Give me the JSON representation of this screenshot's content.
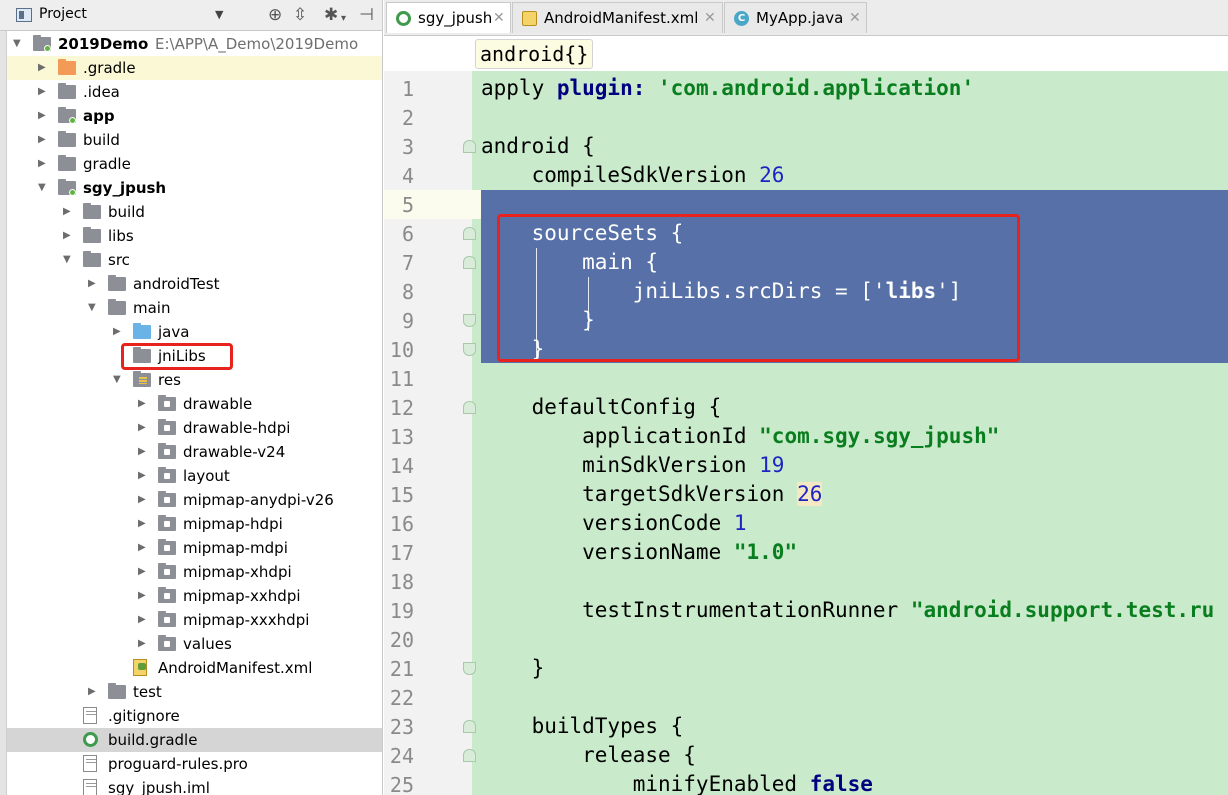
{
  "project_panel": {
    "title": "Project",
    "tree": [
      {
        "label": "2019Demo",
        "path": "E:\\APP\\A_Demo\\2019Demo",
        "depth": 0,
        "expanded": true,
        "icon": "module-folder-icon",
        "bold": true
      },
      {
        "label": ".gradle",
        "depth": 1,
        "expanded": false,
        "icon": "folder-orange-icon",
        "selected": "yellow"
      },
      {
        "label": ".idea",
        "depth": 1,
        "expanded": false,
        "icon": "folder-icon"
      },
      {
        "label": "app",
        "depth": 1,
        "expanded": false,
        "icon": "module-folder-icon",
        "bold": true
      },
      {
        "label": "build",
        "depth": 1,
        "expanded": false,
        "icon": "folder-icon"
      },
      {
        "label": "gradle",
        "depth": 1,
        "expanded": false,
        "icon": "folder-icon"
      },
      {
        "label": "sgy_jpush",
        "depth": 1,
        "expanded": true,
        "icon": "module-folder-icon",
        "bold": true
      },
      {
        "label": "build",
        "depth": 2,
        "expanded": false,
        "icon": "folder-icon"
      },
      {
        "label": "libs",
        "depth": 2,
        "expanded": false,
        "icon": "folder-icon"
      },
      {
        "label": "src",
        "depth": 2,
        "expanded": true,
        "icon": "folder-icon"
      },
      {
        "label": "androidTest",
        "depth": 3,
        "expanded": false,
        "icon": "folder-icon"
      },
      {
        "label": "main",
        "depth": 3,
        "expanded": true,
        "icon": "folder-icon"
      },
      {
        "label": "java",
        "depth": 4,
        "expanded": false,
        "icon": "source-folder-icon"
      },
      {
        "label": "jniLibs",
        "depth": 4,
        "leaf": true,
        "icon": "folder-icon",
        "highlighted": true
      },
      {
        "label": "res",
        "depth": 4,
        "expanded": true,
        "icon": "resources-folder-icon"
      },
      {
        "label": "drawable",
        "depth": 5,
        "expanded": false,
        "icon": "resource-subfolder-icon"
      },
      {
        "label": "drawable-hdpi",
        "depth": 5,
        "expanded": false,
        "icon": "resource-subfolder-icon"
      },
      {
        "label": "drawable-v24",
        "depth": 5,
        "expanded": false,
        "icon": "resource-subfolder-icon"
      },
      {
        "label": "layout",
        "depth": 5,
        "expanded": false,
        "icon": "resource-subfolder-icon"
      },
      {
        "label": "mipmap-anydpi-v26",
        "depth": 5,
        "expanded": false,
        "icon": "resource-subfolder-icon"
      },
      {
        "label": "mipmap-hdpi",
        "depth": 5,
        "expanded": false,
        "icon": "resource-subfolder-icon"
      },
      {
        "label": "mipmap-mdpi",
        "depth": 5,
        "expanded": false,
        "icon": "resource-subfolder-icon"
      },
      {
        "label": "mipmap-xhdpi",
        "depth": 5,
        "expanded": false,
        "icon": "resource-subfolder-icon"
      },
      {
        "label": "mipmap-xxhdpi",
        "depth": 5,
        "expanded": false,
        "icon": "resource-subfolder-icon"
      },
      {
        "label": "mipmap-xxxhdpi",
        "depth": 5,
        "expanded": false,
        "icon": "resource-subfolder-icon"
      },
      {
        "label": "values",
        "depth": 5,
        "expanded": false,
        "icon": "resource-subfolder-icon"
      },
      {
        "label": "AndroidManifest.xml",
        "depth": 4,
        "leaf": true,
        "icon": "manifest-file-icon"
      },
      {
        "label": "test",
        "depth": 3,
        "expanded": false,
        "icon": "folder-icon"
      },
      {
        "label": ".gitignore",
        "depth": 2,
        "leaf": true,
        "icon": "text-file-icon"
      },
      {
        "label": "build.gradle",
        "depth": 2,
        "leaf": true,
        "icon": "gradle-file-icon",
        "selected": "gray"
      },
      {
        "label": "proguard-rules.pro",
        "depth": 2,
        "leaf": true,
        "icon": "text-file-icon"
      },
      {
        "label": "sgy_jpush.iml",
        "depth": 2,
        "leaf": true,
        "icon": "text-file-icon"
      }
    ]
  },
  "tabs": [
    {
      "label": "sgy_jpush",
      "icon": "gradle-icon",
      "active": true
    },
    {
      "label": "AndroidManifest.xml",
      "icon": "xml-file-icon",
      "active": false
    },
    {
      "label": "MyApp.java",
      "icon": "java-class-icon",
      "active": false
    }
  ],
  "breadcrumb": {
    "label": "android{}"
  },
  "editor": {
    "lines": [
      {
        "n": "1",
        "tokens": [
          [
            "apply ",
            "plain"
          ],
          [
            "plugin: ",
            "kw"
          ],
          [
            "'com.android.application'",
            "str"
          ]
        ]
      },
      {
        "n": "2",
        "tokens": []
      },
      {
        "n": "3",
        "tokens": [
          [
            "android {",
            "plain"
          ]
        ],
        "fold": "start"
      },
      {
        "n": "4",
        "tokens": [
          [
            "    compileSdkVersion ",
            "plain"
          ],
          [
            "26",
            "num"
          ]
        ]
      },
      {
        "n": "5",
        "tokens": [],
        "caret": true
      },
      {
        "n": "6",
        "tokens": [
          [
            "    sourceSets {",
            "plain"
          ]
        ],
        "fold": "start",
        "selected": true
      },
      {
        "n": "7",
        "tokens": [
          [
            "        main {",
            "plain"
          ]
        ],
        "fold": "start",
        "selected": true
      },
      {
        "n": "8",
        "tokens": [
          [
            "            jniLibs.srcDirs = ['",
            "plain"
          ],
          [
            "libs",
            "strbold"
          ],
          [
            "']",
            "plain"
          ]
        ],
        "selected": true
      },
      {
        "n": "9",
        "tokens": [
          [
            "        }",
            "plain"
          ]
        ],
        "fold": "end",
        "selected": true
      },
      {
        "n": "10",
        "tokens": [
          [
            "    }",
            "plain"
          ]
        ],
        "fold": "end",
        "selected": true
      },
      {
        "n": "11",
        "tokens": []
      },
      {
        "n": "12",
        "tokens": [
          [
            "    defaultConfig {",
            "plain"
          ]
        ],
        "fold": "start"
      },
      {
        "n": "13",
        "tokens": [
          [
            "        applicationId ",
            "plain"
          ],
          [
            "\"com.sgy.sgy_jpush\"",
            "str"
          ]
        ]
      },
      {
        "n": "14",
        "tokens": [
          [
            "        minSdkVersion ",
            "plain"
          ],
          [
            "19",
            "num"
          ]
        ]
      },
      {
        "n": "15",
        "tokens": [
          [
            "        targetSdkVersion ",
            "plain"
          ],
          [
            "26",
            "numhl"
          ]
        ]
      },
      {
        "n": "16",
        "tokens": [
          [
            "        versionCode ",
            "plain"
          ],
          [
            "1",
            "num"
          ]
        ]
      },
      {
        "n": "17",
        "tokens": [
          [
            "        versionName ",
            "plain"
          ],
          [
            "\"1.0\"",
            "str"
          ]
        ]
      },
      {
        "n": "18",
        "tokens": []
      },
      {
        "n": "19",
        "tokens": [
          [
            "        testInstrumentationRunner ",
            "plain"
          ],
          [
            "\"android.support.test.ru",
            "str"
          ]
        ]
      },
      {
        "n": "20",
        "tokens": []
      },
      {
        "n": "21",
        "tokens": [
          [
            "    }",
            "plain"
          ]
        ],
        "fold": "end"
      },
      {
        "n": "22",
        "tokens": []
      },
      {
        "n": "23",
        "tokens": [
          [
            "    buildTypes {",
            "plain"
          ]
        ],
        "fold": "start"
      },
      {
        "n": "24",
        "tokens": [
          [
            "        release {",
            "plain"
          ]
        ],
        "fold": "start"
      },
      {
        "n": "25",
        "tokens": [
          [
            "            minifyEnabled ",
            "plain"
          ],
          [
            "false",
            "kwnavy"
          ]
        ]
      }
    ]
  },
  "colors": {
    "editor_bg": "#c9ebcb",
    "selection": "#5771a8",
    "annotation_red": "#e8221c"
  }
}
